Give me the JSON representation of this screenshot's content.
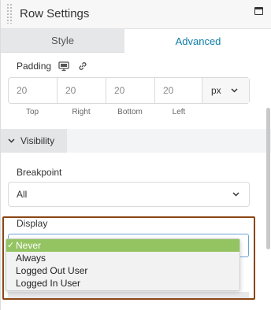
{
  "header": {
    "title": "Row Settings"
  },
  "tabs": [
    {
      "label": "Style",
      "active": false
    },
    {
      "label": "Advanced",
      "active": true
    }
  ],
  "padding": {
    "label": "Padding",
    "values": [
      "20",
      "20",
      "20",
      "20"
    ],
    "sides": [
      "Top",
      "Right",
      "Bottom",
      "Left"
    ],
    "unit": "px"
  },
  "visibility": {
    "section_label": "Visibility",
    "breakpoint_label": "Breakpoint",
    "breakpoint_value": "All",
    "display_label": "Display",
    "display_options": [
      "Never",
      "Always",
      "Logged Out User",
      "Logged In User"
    ],
    "display_selected": "Never"
  },
  "colors": {
    "accent": "#0e7ca8",
    "selected_option": "#94c462",
    "highlight_border": "#8b4513"
  },
  "icons": {
    "responsive": "monitor-icon",
    "link": "link-icon",
    "window": "window-icon"
  }
}
